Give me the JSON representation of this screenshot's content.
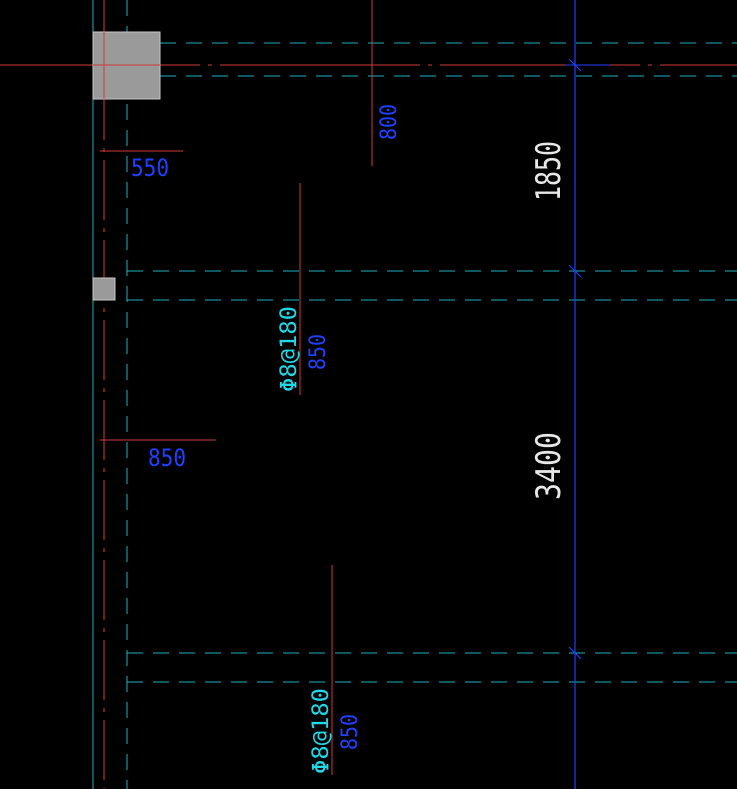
{
  "colors": {
    "background": "#000000",
    "axis_red": "#d03a3a",
    "dash_cyan": "#20b0c0",
    "dim_blue": "#2040ff",
    "text_white": "#e8e8e8",
    "text_cyan": "#20d8e8",
    "column_gray": "#9a9a9a"
  },
  "dimensions": {
    "top_span": "1850",
    "middle_span": "3400"
  },
  "rebar_labels": {
    "top_length": "800",
    "left_top_length": "550",
    "left_mid_length": "850",
    "mid_spec": "Φ8@180",
    "mid_length": "850",
    "bottom_spec": "Φ8@180",
    "bottom_length": "850"
  }
}
